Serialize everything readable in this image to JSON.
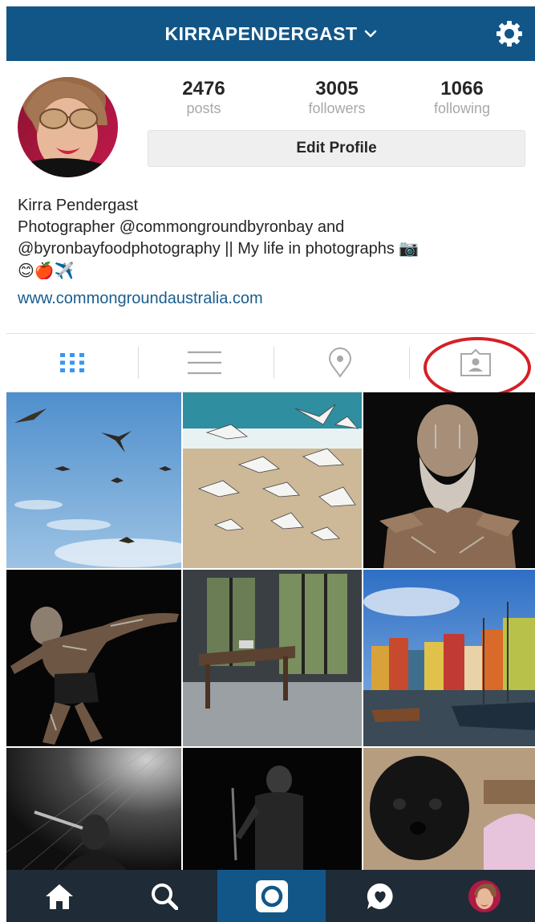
{
  "header": {
    "username": "KIRRAPENDERGAST",
    "username_menu_icon": "chevron-down-icon",
    "settings_icon": "gear-icon"
  },
  "profile": {
    "stats": [
      {
        "value": "2476",
        "label": "posts"
      },
      {
        "value": "3005",
        "label": "followers"
      },
      {
        "value": "1066",
        "label": "following"
      }
    ],
    "edit_button": "Edit Profile",
    "name": "Kirra Pendergast",
    "bio_line1": "Photographer @commongroundbyronbay and",
    "bio_line2": "@byronbayfoodphotography || My life in photographs 📷",
    "bio_line3": "😊🍎✈️",
    "website": "www.commongroundaustralia.com"
  },
  "tabs": [
    {
      "name": "grid",
      "icon": "grid-icon",
      "active": true
    },
    {
      "name": "list",
      "icon": "list-icon",
      "active": false
    },
    {
      "name": "map",
      "icon": "location-pin-icon",
      "active": false
    },
    {
      "name": "tagged",
      "icon": "tagged-photos-icon",
      "active": false
    }
  ],
  "annotation": {
    "color": "#d42027",
    "target": "tagged-photos-tab"
  },
  "photos": [
    {
      "subject": "birds in blue sky"
    },
    {
      "subject": "seagulls on beach"
    },
    {
      "subject": "aboriginal elder with body paint"
    },
    {
      "subject": "painted dancer"
    },
    {
      "subject": "empty room with table"
    },
    {
      "subject": "nyhavn harbour"
    },
    {
      "subject": "singer on stage black and white"
    },
    {
      "subject": "performer on dark stage"
    },
    {
      "subject": "black dog"
    }
  ],
  "bottom_nav": [
    {
      "icon": "home-icon",
      "active": false
    },
    {
      "icon": "search-icon",
      "active": false
    },
    {
      "icon": "camera-icon",
      "active": true
    },
    {
      "icon": "activity-icon",
      "active": false
    },
    {
      "icon": "profile-avatar-icon",
      "active": false
    }
  ],
  "colors": {
    "header_bg": "#125688",
    "nav_bg": "#1f2b36",
    "link": "#1a5d8f",
    "active_tab": "#3897f0"
  }
}
